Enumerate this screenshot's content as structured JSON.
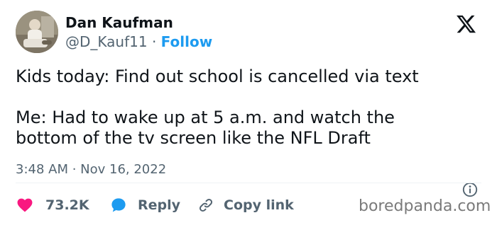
{
  "author": {
    "display_name": "Dan Kaufman",
    "handle": "@D_Kauf11",
    "separator": "·",
    "follow_label": "Follow"
  },
  "tweet": {
    "paragraphs": [
      "Kids today: Find out school is cancelled via text",
      "Me: Had to wake up at 5 a.m. and watch the\nbottom of the tv screen like the NFL Draft"
    ],
    "timestamp": "3:48 AM · Nov 16, 2022"
  },
  "actions": {
    "like_count": "73.2K",
    "reply_label": "Reply",
    "copy_link_label": "Copy link"
  },
  "colors": {
    "accent": "#1d9bf0",
    "like": "#f91880",
    "secondary_text": "#536471",
    "primary_text": "#0f1419"
  },
  "icons": {
    "brand": "x-logo-icon",
    "info": "info-icon",
    "like": "heart-icon",
    "reply": "speech-bubble-icon",
    "copy": "link-icon"
  },
  "watermark": "boredpanda.com"
}
